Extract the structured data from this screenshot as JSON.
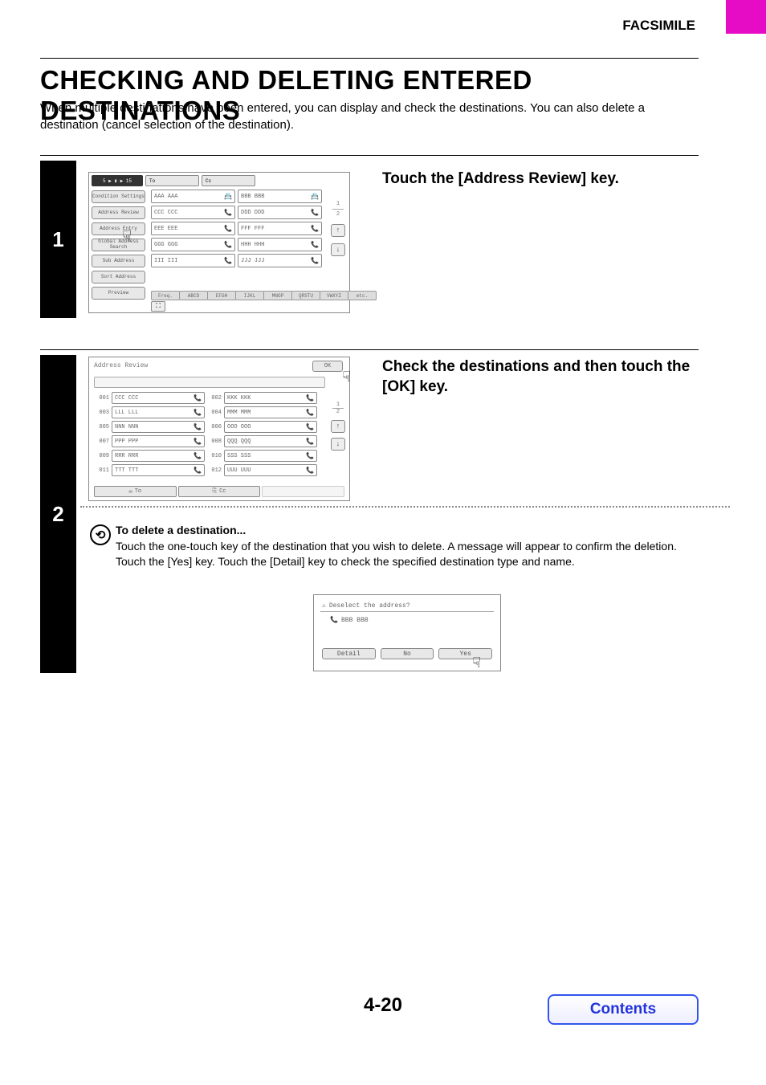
{
  "header": "FACSIMILE",
  "title": "CHECKING AND DELETING ENTERED DESTINATIONS",
  "intro": "When multiple destinations have been entered, you can display and check the destinations. You can also delete a destination (cancel selection of the destination).",
  "step1": {
    "num": "1",
    "heading": "Touch the [Address Review] key.",
    "breadcrumb": "5 ▶ ▮ ▶ 15",
    "toBtn": "To",
    "ccBtn": "Cc",
    "leftButtons": [
      "Condition\nSettings",
      "Address Review",
      "Address Entry",
      "Global\nAddress Search",
      "Sub Address",
      "Sort Address",
      "Preview"
    ],
    "cells": [
      {
        "t": "AAA AAA",
        "i": "📇"
      },
      {
        "t": "BBB BBB",
        "i": "📇"
      },
      {
        "t": "CCC CCC",
        "i": "📞"
      },
      {
        "t": "DDD DDD",
        "i": "📞"
      },
      {
        "t": "EEE EEE",
        "i": "📞"
      },
      {
        "t": "FFF FFF",
        "i": "📞"
      },
      {
        "t": "GGG GGG",
        "i": "📞"
      },
      {
        "t": "HHH HHH",
        "i": "📞"
      },
      {
        "t": "III III",
        "i": "📞"
      },
      {
        "t": "JJJ JJJ",
        "i": "📞"
      }
    ],
    "tabs": [
      "Freq.",
      "ABCD",
      "EFGH",
      "IJKL",
      "MNOP",
      "QRSTU",
      "VWXYZ",
      "etc."
    ],
    "page1": "1",
    "page2": "2",
    "arrowUp": "↑",
    "arrowDown": "↓"
  },
  "step2": {
    "num": "2",
    "heading": "Check the destinations and then touch the [OK] key.",
    "reviewLabel": "Address Review",
    "ok": "OK",
    "rows": [
      {
        "n": "001",
        "t": "CCC CCC"
      },
      {
        "n": "002",
        "t": "KKK KKK"
      },
      {
        "n": "003",
        "t": "LLL LLL"
      },
      {
        "n": "004",
        "t": "MMM MMM"
      },
      {
        "n": "005",
        "t": "NNN NNN"
      },
      {
        "n": "006",
        "t": "OOO OOO"
      },
      {
        "n": "007",
        "t": "PPP PPP"
      },
      {
        "n": "008",
        "t": "QQQ QQQ"
      },
      {
        "n": "009",
        "t": "RRR RRR"
      },
      {
        "n": "010",
        "t": "SSS SSS"
      },
      {
        "n": "011",
        "t": "TTT TTT"
      },
      {
        "n": "012",
        "t": "UUU UUU"
      }
    ],
    "bottomTo": "To",
    "bottomCc": "Cc",
    "arrowUp": "↑",
    "arrowDown": "↓",
    "page1": "1",
    "page2": "2",
    "info_title": "To delete a destination...",
    "info_body": "Touch the one-touch key of the destination that you wish to delete. A message will appear to confirm the deletion. Touch the [Yes] key. Touch the [Detail] key to check the specified destination type and name.",
    "dialog": {
      "msg": "Deselect the address?",
      "addr": "BBB BBB",
      "detail": "Detail",
      "no": "No",
      "yes": "Yes"
    }
  },
  "pageNumber": "4-20",
  "contents": "Contents"
}
